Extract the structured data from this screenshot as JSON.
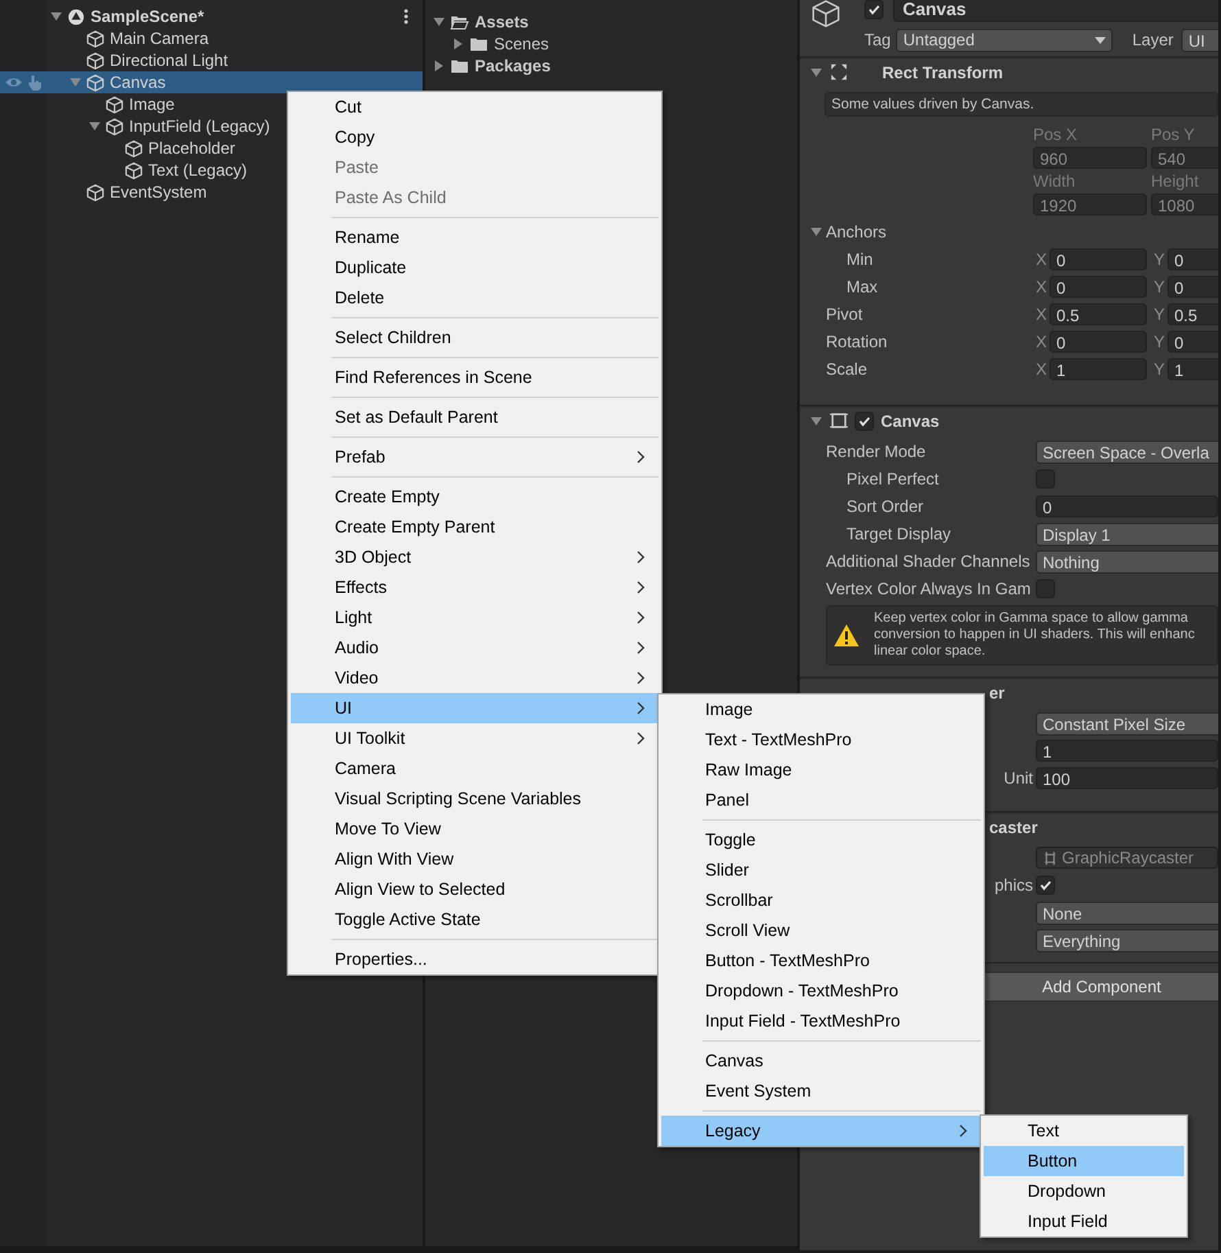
{
  "hierarchy": {
    "scene": {
      "name": "SampleScene*",
      "expanded": true
    },
    "items": [
      {
        "name": "Main Camera",
        "selected": false
      },
      {
        "name": "Directional Light",
        "selected": false
      },
      {
        "name": "Canvas",
        "selected": true,
        "expanded": true,
        "children": [
          {
            "name": "Image",
            "selected": false
          },
          {
            "name": "InputField (Legacy)",
            "selected": false,
            "expanded": true,
            "children": [
              {
                "name": "Placeholder",
                "selected": false
              },
              {
                "name": "Text (Legacy)",
                "selected": false
              }
            ]
          }
        ]
      },
      {
        "name": "EventSystem",
        "selected": false
      }
    ]
  },
  "project": {
    "folders": [
      {
        "name": "Assets",
        "expanded": true,
        "children": [
          {
            "name": "Scenes",
            "expanded": false
          }
        ]
      },
      {
        "name": "Packages",
        "expanded": false
      }
    ]
  },
  "inspector": {
    "object": {
      "name": "Canvas",
      "active": true,
      "tag_label": "Tag",
      "tag": "Untagged",
      "layer_label": "Layer",
      "layer": "UI"
    },
    "components": [
      {
        "kind": "rect_transform",
        "title": "Rect Transform",
        "expanded": true,
        "rows": [
          {
            "kind": "note",
            "text": "Some values driven by Canvas."
          },
          {
            "kind": "grid",
            "cells": [
              {
                "label": "Pos X",
                "value": "960"
              },
              {
                "label": "Pos Y",
                "value": "540"
              },
              {
                "label": "Width",
                "value": "1920"
              },
              {
                "label": "Height",
                "value": "1080"
              }
            ]
          },
          {
            "kind": "foldout",
            "label": "Anchors",
            "expanded": true,
            "children": [
              {
                "kind": "vector",
                "label": "Min",
                "fields": [
                  {
                    "axis": "X",
                    "value": "0"
                  },
                  {
                    "axis": "Y",
                    "value": "0"
                  }
                ]
              },
              {
                "kind": "vector",
                "label": "Max",
                "fields": [
                  {
                    "axis": "X",
                    "value": "0"
                  },
                  {
                    "axis": "Y",
                    "value": "0"
                  }
                ]
              }
            ]
          },
          {
            "kind": "vector",
            "label": "Pivot",
            "fields": [
              {
                "axis": "X",
                "value": "0.5"
              },
              {
                "axis": "Y",
                "value": "0.5"
              }
            ]
          },
          {
            "kind": "vector",
            "label": "Rotation",
            "fields": [
              {
                "axis": "X",
                "value": "0"
              },
              {
                "axis": "Y",
                "value": "0"
              }
            ]
          },
          {
            "kind": "vector",
            "label": "Scale",
            "fields": [
              {
                "axis": "X",
                "value": "1"
              },
              {
                "axis": "Y",
                "value": "1"
              }
            ]
          }
        ]
      },
      {
        "kind": "canvas",
        "title": "Canvas",
        "expanded": true,
        "enabled": true,
        "rows": [
          {
            "kind": "dropdown",
            "label": "Render Mode",
            "value": "Screen Space - Overla",
            "children": [
              {
                "kind": "checkbox",
                "label": "Pixel Perfect",
                "checked": false
              },
              {
                "kind": "field",
                "label": "Sort Order",
                "value": "0"
              },
              {
                "kind": "dropdown",
                "label": "Target Display",
                "value": "Display 1"
              }
            ]
          },
          {
            "kind": "dropdown",
            "label": "Additional Shader Channels",
            "value": "Nothing"
          },
          {
            "kind": "checkbox",
            "label": "Vertex Color Always In Gam",
            "checked": false
          },
          {
            "kind": "help",
            "lines": [
              "Keep vertex color in Gamma space to allow gamma",
              "conversion to happen in UI shaders. This will enhanc",
              "linear color space."
            ]
          }
        ]
      },
      {
        "kind": "canvas_scaler",
        "title": "er",
        "rows": [
          {
            "kind": "dropdown",
            "value": "Constant Pixel Size"
          },
          {
            "kind": "field",
            "value": "1"
          },
          {
            "kind": "field",
            "label": "Unit",
            "value": "100"
          }
        ]
      },
      {
        "kind": "graphic_raycaster",
        "title": "caster",
        "rows": [
          {
            "kind": "object",
            "value": "GraphicRaycaster"
          },
          {
            "kind": "checkbox",
            "label": "phics",
            "checked": true
          },
          {
            "kind": "dropdown",
            "value": "None"
          },
          {
            "kind": "dropdown",
            "value": "Everything"
          }
        ]
      }
    ],
    "add_button": "Add Component"
  },
  "context_menu": {
    "items": [
      {
        "kind": "item",
        "label": "Cut",
        "disabled": false,
        "selected": false,
        "submenu": false
      },
      {
        "kind": "item",
        "label": "Copy",
        "disabled": false,
        "selected": false,
        "submenu": false
      },
      {
        "kind": "item",
        "label": "Paste",
        "disabled": true,
        "selected": false,
        "submenu": false
      },
      {
        "kind": "item",
        "label": "Paste As Child",
        "disabled": true,
        "selected": false,
        "submenu": false
      },
      {
        "kind": "separator"
      },
      {
        "kind": "item",
        "label": "Rename",
        "disabled": false,
        "selected": false,
        "submenu": false
      },
      {
        "kind": "item",
        "label": "Duplicate",
        "disabled": false,
        "selected": false,
        "submenu": false
      },
      {
        "kind": "item",
        "label": "Delete",
        "disabled": false,
        "selected": false,
        "submenu": false
      },
      {
        "kind": "separator"
      },
      {
        "kind": "item",
        "label": "Select Children",
        "disabled": false,
        "selected": false,
        "submenu": false
      },
      {
        "kind": "separator"
      },
      {
        "kind": "item",
        "label": "Find References in Scene",
        "disabled": false,
        "selected": false,
        "submenu": false
      },
      {
        "kind": "separator"
      },
      {
        "kind": "item",
        "label": "Set as Default Parent",
        "disabled": false,
        "selected": false,
        "submenu": false
      },
      {
        "kind": "separator"
      },
      {
        "kind": "item",
        "label": "Prefab",
        "disabled": false,
        "selected": false,
        "submenu": true
      },
      {
        "kind": "separator"
      },
      {
        "kind": "item",
        "label": "Create Empty",
        "disabled": false,
        "selected": false,
        "submenu": false
      },
      {
        "kind": "item",
        "label": "Create Empty Parent",
        "disabled": false,
        "selected": false,
        "submenu": false
      },
      {
        "kind": "item",
        "label": "3D Object",
        "disabled": false,
        "selected": false,
        "submenu": true
      },
      {
        "kind": "item",
        "label": "Effects",
        "disabled": false,
        "selected": false,
        "submenu": true
      },
      {
        "kind": "item",
        "label": "Light",
        "disabled": false,
        "selected": false,
        "submenu": true
      },
      {
        "kind": "item",
        "label": "Audio",
        "disabled": false,
        "selected": false,
        "submenu": true
      },
      {
        "kind": "item",
        "label": "Video",
        "disabled": false,
        "selected": false,
        "submenu": true
      },
      {
        "kind": "item",
        "label": "UI",
        "disabled": false,
        "selected": true,
        "submenu": true
      },
      {
        "kind": "item",
        "label": "UI Toolkit",
        "disabled": false,
        "selected": false,
        "submenu": true
      },
      {
        "kind": "item",
        "label": "Camera",
        "disabled": false,
        "selected": false,
        "submenu": false
      },
      {
        "kind": "item",
        "label": "Visual Scripting Scene Variables",
        "disabled": false,
        "selected": false,
        "submenu": false
      },
      {
        "kind": "item",
        "label": "Move To View",
        "disabled": false,
        "selected": false,
        "submenu": false
      },
      {
        "kind": "item",
        "label": "Align With View",
        "disabled": false,
        "selected": false,
        "submenu": false
      },
      {
        "kind": "item",
        "label": "Align View to Selected",
        "disabled": false,
        "selected": false,
        "submenu": false
      },
      {
        "kind": "item",
        "label": "Toggle Active State",
        "disabled": false,
        "selected": false,
        "submenu": false
      },
      {
        "kind": "separator"
      },
      {
        "kind": "item",
        "label": "Properties...",
        "disabled": false,
        "selected": false,
        "submenu": false
      }
    ]
  },
  "ui_submenu": {
    "items": [
      {
        "kind": "item",
        "label": "Image",
        "disabled": false,
        "selected": false,
        "submenu": false
      },
      {
        "kind": "item",
        "label": "Text - TextMeshPro",
        "disabled": false,
        "selected": false,
        "submenu": false
      },
      {
        "kind": "item",
        "label": "Raw Image",
        "disabled": false,
        "selected": false,
        "submenu": false
      },
      {
        "kind": "item",
        "label": "Panel",
        "disabled": false,
        "selected": false,
        "submenu": false
      },
      {
        "kind": "separator"
      },
      {
        "kind": "item",
        "label": "Toggle",
        "disabled": false,
        "selected": false,
        "submenu": false
      },
      {
        "kind": "item",
        "label": "Slider",
        "disabled": false,
        "selected": false,
        "submenu": false
      },
      {
        "kind": "item",
        "label": "Scrollbar",
        "disabled": false,
        "selected": false,
        "submenu": false
      },
      {
        "kind": "item",
        "label": "Scroll View",
        "disabled": false,
        "selected": false,
        "submenu": false
      },
      {
        "kind": "item",
        "label": "Button - TextMeshPro",
        "disabled": false,
        "selected": false,
        "submenu": false
      },
      {
        "kind": "item",
        "label": "Dropdown - TextMeshPro",
        "disabled": false,
        "selected": false,
        "submenu": false
      },
      {
        "kind": "item",
        "label": "Input Field - TextMeshPro",
        "disabled": false,
        "selected": false,
        "submenu": false
      },
      {
        "kind": "separator"
      },
      {
        "kind": "item",
        "label": "Canvas",
        "disabled": false,
        "selected": false,
        "submenu": false
      },
      {
        "kind": "item",
        "label": "Event System",
        "disabled": false,
        "selected": false,
        "submenu": false
      },
      {
        "kind": "separator"
      },
      {
        "kind": "item",
        "label": "Legacy",
        "disabled": false,
        "selected": true,
        "submenu": true
      }
    ]
  },
  "legacy_submenu": {
    "items": [
      {
        "kind": "item",
        "label": "Text",
        "disabled": false,
        "selected": false,
        "submenu": false
      },
      {
        "kind": "item",
        "label": "Button",
        "disabled": false,
        "selected": true,
        "submenu": false
      },
      {
        "kind": "item",
        "label": "Dropdown",
        "disabled": false,
        "selected": false,
        "submenu": false
      },
      {
        "kind": "item",
        "label": "Input Field",
        "disabled": false,
        "selected": false,
        "submenu": false
      }
    ]
  }
}
